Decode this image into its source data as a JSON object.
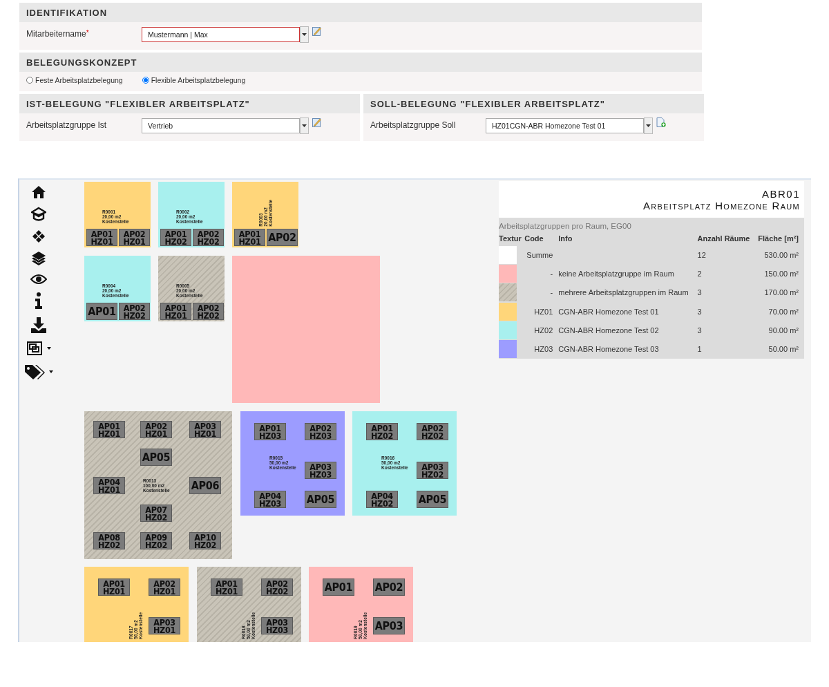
{
  "identifikation": {
    "title": "IDENTIFIKATION",
    "field": {
      "label": "Mitarbeitername",
      "required_mark": "*",
      "value": "Mustermann | Max",
      "invalid": true,
      "kind": "edit"
    }
  },
  "belegungskonzept": {
    "title": "BELEGUNGSKONZEPT",
    "options": [
      {
        "label": "Feste Arbeitsplatzbelegung",
        "selected": false
      },
      {
        "label": "Flexible Arbeitsplatzbelegung",
        "selected": true
      }
    ]
  },
  "ist": {
    "title": "IST-BELEGUNG \"FLEXIBLER ARBEITSPLATZ\"",
    "field": {
      "label": "Arbeitsplatzgruppe Ist",
      "value": "Vertrieb",
      "invalid": false,
      "kind": "edit"
    }
  },
  "soll": {
    "title": "SOLL-BELEGUNG \"FLEXIBLER ARBEITSPLATZ\"",
    "field": {
      "label": "Arbeitsplatzgruppe Soll",
      "value": "HZ01CGN-ABR Homezone Test 01",
      "invalid": false,
      "kind": "add"
    }
  },
  "toolbar": [
    {
      "kind": "home"
    },
    {
      "kind": "cap"
    },
    {
      "kind": "diamonds"
    },
    {
      "kind": "layers"
    },
    {
      "kind": "eye"
    },
    {
      "kind": "info"
    },
    {
      "kind": "download"
    },
    {
      "kind": "frame",
      "dropdown": true
    },
    {
      "kind": "tags",
      "dropdown": true
    }
  ],
  "floor_plan": {
    "rooms": [
      {
        "kind": "hz01",
        "rotated": false,
        "label": [
          "R0001",
          "20,00 m2",
          "Kostenstelle"
        ],
        "workplaces": [
          {
            "ap": "AP01",
            "hz": "HZ01"
          },
          {
            "ap": "AP02",
            "hz": "HZ01"
          }
        ]
      },
      {
        "kind": "hz02",
        "rotated": false,
        "label": [
          "R0002",
          "20,00 m2",
          "Kostenstelle"
        ],
        "workplaces": [
          {
            "ap": "AP01",
            "hz": "HZ02"
          },
          {
            "ap": "AP02",
            "hz": "HZ02"
          }
        ]
      },
      {
        "kind": "hz01",
        "rotated": true,
        "label": [
          "R0003",
          "20,00 m2",
          "Kostenstelle"
        ],
        "workplaces": [
          {
            "ap": "AP01",
            "hz": "HZ01"
          },
          {
            "ap": "AP02"
          }
        ]
      },
      {
        "kind": "hz02",
        "rotated": false,
        "label": [
          "R0004",
          "20,00 m2",
          "Kostenstelle"
        ],
        "workplaces": [
          {
            "ap": "AP01"
          },
          {
            "ap": "AP02",
            "hz": "HZ02"
          }
        ]
      },
      {
        "kind": "multi",
        "rotated": false,
        "label": [
          "R0005",
          "20,00 m2",
          "Kostenstelle"
        ],
        "workplaces": [
          {
            "ap": "AP01",
            "hz": "HZ01"
          },
          {
            "ap": "AP02",
            "hz": "HZ02"
          }
        ]
      },
      {
        "kind": "none"
      },
      {
        "kind": "multi",
        "rotated": false,
        "label": [
          "R0013",
          "100,00 m2",
          "Kostenstelle"
        ],
        "workplaces": [
          {
            "ap": "AP01",
            "hz": "HZ01"
          },
          {
            "ap": "AP02",
            "hz": "HZ01"
          },
          {
            "ap": "AP03",
            "hz": "HZ01"
          },
          {
            "ap": "AP05"
          },
          {
            "ap": "AP04",
            "hz": "HZ01"
          },
          {
            "ap": "AP06"
          },
          {
            "ap": "AP07",
            "hz": "HZ02"
          },
          {
            "ap": "AP08",
            "hz": "HZ02"
          },
          {
            "ap": "AP09",
            "hz": "HZ02"
          },
          {
            "ap": "AP10",
            "hz": "HZ02"
          }
        ]
      },
      {
        "kind": "hz03",
        "rotated": false,
        "label": [
          "R0015",
          "50,00 m2",
          "Kostenstelle"
        ],
        "workplaces": [
          {
            "ap": "AP01",
            "hz": "HZ03"
          },
          {
            "ap": "AP02",
            "hz": "HZ03"
          },
          {
            "ap": "AP03",
            "hz": "HZ03"
          },
          {
            "ap": "AP04",
            "hz": "HZ03"
          },
          {
            "ap": "AP05"
          }
        ]
      },
      {
        "kind": "hz02",
        "rotated": false,
        "label": [
          "R0016",
          "50,00 m2",
          "Kostenstelle"
        ],
        "workplaces": [
          {
            "ap": "AP01",
            "hz": "HZ02"
          },
          {
            "ap": "AP02",
            "hz": "HZ02"
          },
          {
            "ap": "AP03",
            "hz": "HZ02"
          },
          {
            "ap": "AP04",
            "hz": "HZ02"
          },
          {
            "ap": "AP05"
          }
        ]
      },
      {
        "kind": "hz01",
        "rotated": true,
        "label": [
          "R0017",
          "50,00 m2",
          "Kostenstelle"
        ],
        "workplaces": [
          {
            "ap": "AP01",
            "hz": "HZ01"
          },
          {
            "ap": "AP02",
            "hz": "HZ01"
          },
          {
            "ap": "AP03",
            "hz": "HZ01"
          }
        ]
      },
      {
        "kind": "multi",
        "rotated": true,
        "label": [
          "R0018",
          "50,00 m2",
          "Kostenstelle"
        ],
        "workplaces": [
          {
            "ap": "AP01",
            "hz": "HZ01"
          },
          {
            "ap": "AP02",
            "hz": "HZ02"
          },
          {
            "ap": "AP03",
            "hz": "HZ03"
          }
        ]
      },
      {
        "kind": "none",
        "rotated": true,
        "label": [
          "R0019",
          "50,00 m2",
          "Kostenstelle"
        ],
        "workplaces": [
          {
            "ap": "AP01"
          },
          {
            "ap": "AP02"
          },
          {
            "ap": "AP03"
          }
        ]
      }
    ]
  },
  "legend": {
    "title": "ABR01",
    "subtitle": "Arbeitsplatz Homezone Raum",
    "caption": "Arbeitsplatzgruppen pro Raum, EG00",
    "columns": [
      "Textur",
      "Code",
      "Info",
      "Anzahl Räume",
      "Fläche [m²]"
    ],
    "rows": [
      {
        "kind": "plain",
        "code": "Summe",
        "count": "12",
        "area": "530.00 m²"
      },
      {
        "kind": "none",
        "code": "-",
        "info": "keine Arbeitsplatzgruppe im Raum",
        "count": "2",
        "area": "150.00 m²"
      },
      {
        "kind": "multi",
        "code": "-",
        "info": "mehrere Arbeitsplatzgruppen im Raum",
        "count": "3",
        "area": "170.00 m²"
      },
      {
        "kind": "hz01",
        "code": "HZ01",
        "info": "CGN-ABR Homezone Test 01",
        "count": "3",
        "area": "70.00 m²"
      },
      {
        "kind": "hz02",
        "code": "HZ02",
        "info": "CGN-ABR Homezone Test 02",
        "count": "3",
        "area": "90.00 m²"
      },
      {
        "kind": "hz03",
        "code": "HZ03",
        "info": "CGN-ABR Homezone Test 03",
        "count": "1",
        "area": "50.00 m²"
      }
    ]
  }
}
